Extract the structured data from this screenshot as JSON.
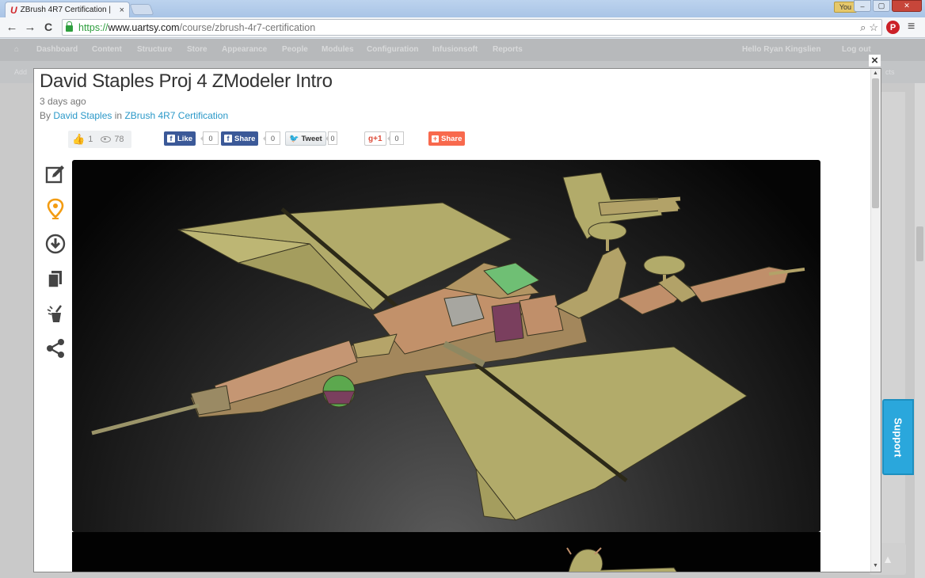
{
  "browser": {
    "tab_title": "ZBrush 4R7 Certification |",
    "tab_favicon": "U",
    "tab_close": "×",
    "user_chip": "You",
    "url_scheme": "https://",
    "url_host": "www.uartsy.com",
    "url_path": "/course/zbrush-4r7-certification",
    "icons": {
      "back": "←",
      "forward": "→",
      "reload": "C",
      "search": "⌕",
      "star": "☆",
      "pinterest": "P",
      "menu": "≡"
    }
  },
  "adminbar": {
    "items": [
      "Dashboard",
      "Content",
      "Structure",
      "Store",
      "Appearance",
      "People",
      "Modules",
      "Configuration",
      "Infusionsoft",
      "Reports"
    ],
    "greeting": "Hello Ryan Kingslien",
    "logout": "Log out",
    "subbar_left": "Add",
    "subbar_right": "cts"
  },
  "post": {
    "title": "David Staples Proj 4 ZModeler Intro",
    "time": "3 days ago",
    "by_prefix": "By",
    "author": "David Staples",
    "in_word": "in",
    "course": "ZBrush 4R7 Certification",
    "likes": "1",
    "views": "78"
  },
  "share": {
    "fb_like": "Like",
    "fb_like_count": "0",
    "fb_share": "Share",
    "fb_share_count": "0",
    "tweet": "Tweet",
    "tweet_count": "0",
    "gplus": "g+1",
    "gplus_count": "0",
    "addthis": "Share"
  },
  "support": {
    "label": "Support"
  },
  "modal": {
    "close": "×"
  },
  "colors": {
    "link": "#2a98c8",
    "facebook": "#3b5998",
    "addthis": "#f8694d",
    "support": "#2aa7dc",
    "accent_orange": "#f39c12"
  }
}
